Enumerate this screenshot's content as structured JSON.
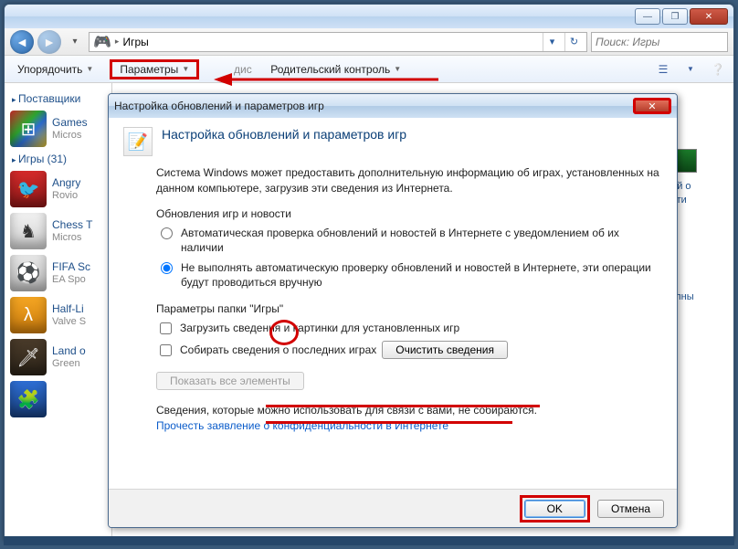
{
  "window": {
    "address_location": "Игры",
    "search_placeholder": "Поиск: Игры"
  },
  "toolbar": {
    "organize": "Упорядочить",
    "parameters": "Параметры",
    "hidden_suffix": "дис",
    "parental": "Родительский контроль"
  },
  "sidebar": {
    "providers_header": "Поставщики",
    "games_header": "Игры (31)",
    "items": [
      {
        "name": "Games",
        "meta": "Micros"
      },
      {
        "name": "Angry",
        "meta": "Rovio"
      },
      {
        "name": "Chess T",
        "meta": "Micros"
      },
      {
        "name": "FIFA Sc",
        "meta": "EA Spo"
      },
      {
        "name": "Half-Li",
        "meta": "Valve S"
      },
      {
        "name": "Land o",
        "meta": "Green"
      }
    ]
  },
  "rightpanel": {
    "line1": "ний о",
    "line2": "ости",
    "line3": "тупны"
  },
  "dialog": {
    "title": "Настройка обновлений и параметров игр",
    "heading": "Настройка обновлений и параметров игр",
    "description": "Система Windows может предоставить дополнительную информацию об играх, установленных на данном компьютере, загрузив эти сведения из Интернета.",
    "group1_title": "Обновления игр и новости",
    "radio1": "Автоматическая проверка обновлений и новостей в Интернете с уведомлением об их наличии",
    "radio2": "Не выполнять автоматическую проверку обновлений и новостей в Интернете, эти операции будут проводиться вручную",
    "group2_title": "Параметры папки \"Игры\"",
    "check1": "Загрузить сведения и картинки для установленных игр",
    "check2": "Собирать сведения о последних играх",
    "clear_btn": "Очистить сведения",
    "show_all": "Показать все элементы",
    "note": "Сведения, которые можно использовать для связи с вами, не собираются.",
    "link": "Прочесть заявление о конфиденциальности в Интернете",
    "ok": "OK",
    "cancel": "Отмена"
  }
}
